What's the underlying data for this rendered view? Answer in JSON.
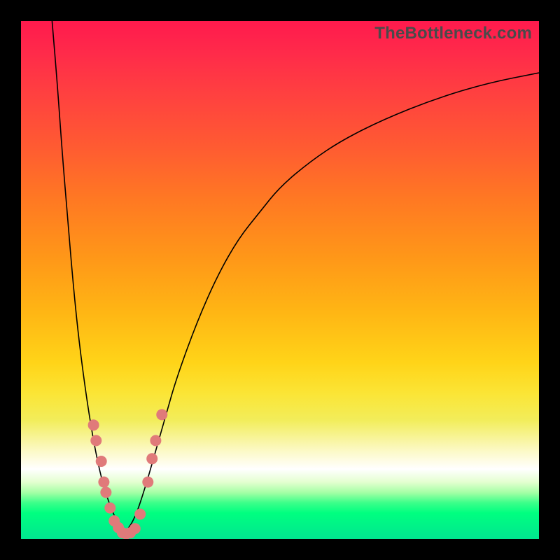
{
  "watermark": "TheBottleneck.com",
  "colors": {
    "background_black": "#000000",
    "dot_fill": "#e07a7a",
    "curve_stroke": "#000000"
  },
  "chart_data": {
    "type": "line",
    "title": "",
    "xlabel": "",
    "ylabel": "",
    "xlim": [
      0,
      100
    ],
    "ylim": [
      0,
      100
    ],
    "legend": false,
    "grid": false,
    "curves": [
      {
        "name": "left_branch",
        "x": [
          6,
          7,
          8,
          9,
          10,
          11,
          12,
          13,
          14,
          15,
          16,
          17,
          18,
          19,
          20
        ],
        "y": [
          100,
          88,
          74,
          62,
          50,
          40,
          32,
          25,
          19,
          14,
          10,
          7,
          4.5,
          2.5,
          1
        ]
      },
      {
        "name": "right_branch",
        "x": [
          20,
          22,
          24,
          26,
          28,
          30,
          34,
          38,
          42,
          46,
          50,
          56,
          62,
          70,
          80,
          90,
          100
        ],
        "y": [
          1,
          4,
          10,
          17,
          24,
          31,
          42,
          51,
          58,
          63,
          68,
          73,
          77,
          81,
          85,
          88,
          90
        ]
      }
    ],
    "scatter": {
      "name": "dots",
      "points": [
        {
          "x": 14.0,
          "y": 22
        },
        {
          "x": 14.5,
          "y": 19
        },
        {
          "x": 15.5,
          "y": 15
        },
        {
          "x": 16.0,
          "y": 11
        },
        {
          "x": 16.4,
          "y": 9
        },
        {
          "x": 17.2,
          "y": 6
        },
        {
          "x": 18.0,
          "y": 3.5
        },
        {
          "x": 18.8,
          "y": 2.2
        },
        {
          "x": 19.6,
          "y": 1.2
        },
        {
          "x": 20.3,
          "y": 1.0
        },
        {
          "x": 21.1,
          "y": 1.2
        },
        {
          "x": 22.0,
          "y": 2.0
        },
        {
          "x": 23.0,
          "y": 4.8
        },
        {
          "x": 24.5,
          "y": 11
        },
        {
          "x": 25.3,
          "y": 15.5
        },
        {
          "x": 26.0,
          "y": 19
        },
        {
          "x": 27.2,
          "y": 24
        }
      ]
    }
  }
}
